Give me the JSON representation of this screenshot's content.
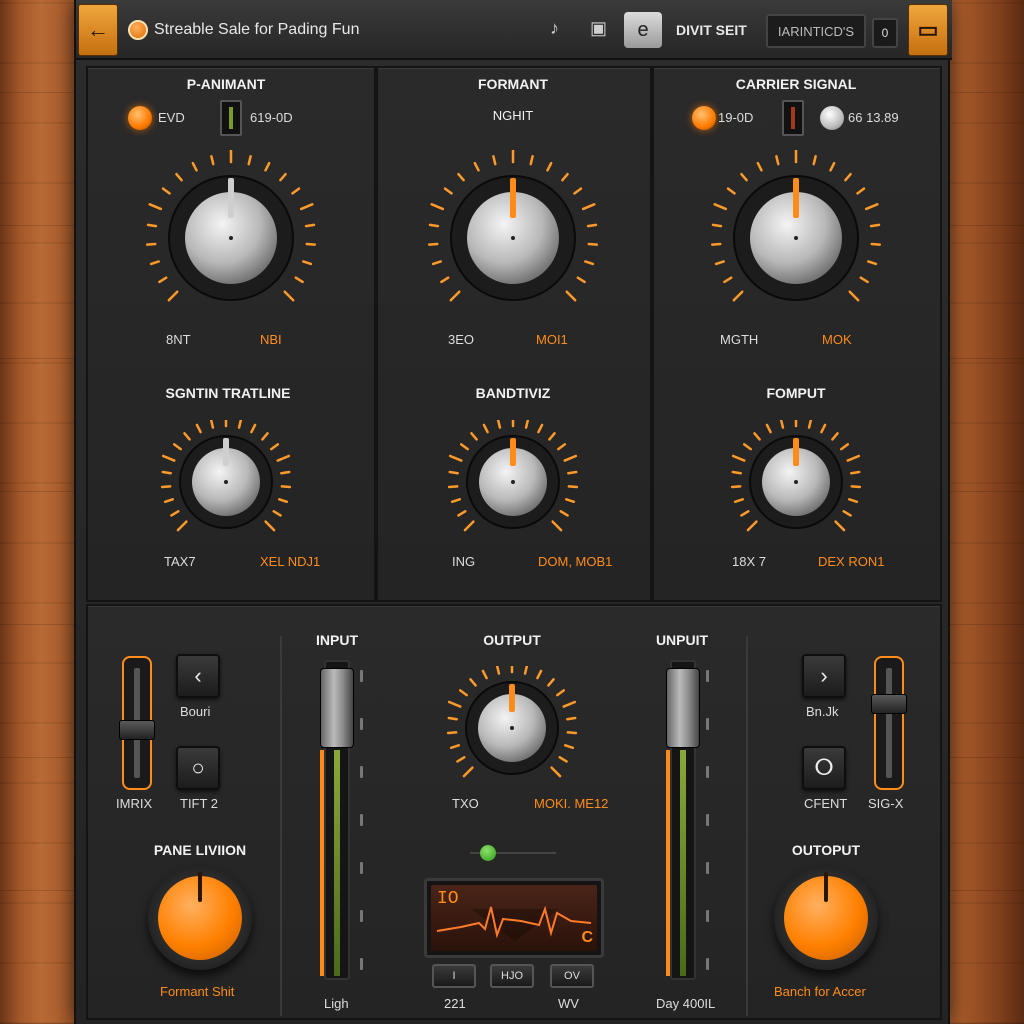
{
  "topbar": {
    "back_icon": "arrow-left-icon",
    "title": "Streable Sale for Pading Fun",
    "label": "DIVIT SEIT",
    "display_value": "IARINTICD'S",
    "zero_value": "0",
    "e_button": "e",
    "menu_icon": "menu-icon"
  },
  "panels": {
    "p1": {
      "title": "P-ANIMANT",
      "led_label": "EVD",
      "value": "619-0D",
      "min_label": "8NT",
      "max_label": "NBI",
      "knob2_title": "SGNTIN TRATLINE",
      "knob2_min": "TAX7",
      "knob2_max": "XEL NDJ1"
    },
    "p2": {
      "title": "FORMANT",
      "sub": "NGHIT",
      "min_label": "3EO",
      "max_label": "MOI1",
      "knob2_title": "BANDTIVIZ",
      "knob2_min": "ING",
      "knob2_max": "DOM, MOB1"
    },
    "p3": {
      "title": "CARRIER SIGNAL",
      "led_label": "19-0D",
      "value2": "66 13.89",
      "min_label": "MGTH",
      "max_label": "MOK",
      "knob2_title": "FOMPUT",
      "knob2_min": "18X 7",
      "knob2_max": "DEX RON1"
    }
  },
  "bottom": {
    "left": {
      "btn1_label": "Bouri",
      "btn2_label": "TIFT 2",
      "slider_label": "IMRIX",
      "knob_title": "PANE LIVIION",
      "knob_caption": "Formant Shit"
    },
    "input": {
      "title": "INPUT",
      "caption": "Ligh"
    },
    "output": {
      "title": "OUTPUT",
      "min_label": "TXO",
      "max_label": "MOKI. ME12",
      "display_left": "IO",
      "display_right": "C",
      "btn1": "I",
      "btn2": "HJO",
      "btn3": "OV",
      "caption_left": "221",
      "caption_right": "WV"
    },
    "unput": {
      "title": "UNPUIT",
      "caption": "Day 400IL"
    },
    "right": {
      "btn1_label": "Bn.Jk",
      "btn2_label": "CFENT",
      "slider_label": "SIG-X",
      "knob_title": "OUTOPUT",
      "knob_caption": "Banch for Accer"
    }
  }
}
